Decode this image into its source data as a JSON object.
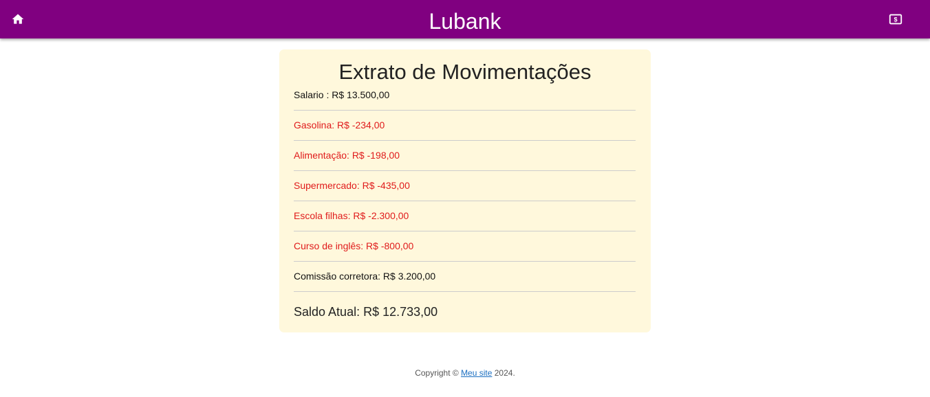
{
  "header": {
    "brand": "Lubank",
    "home_icon": "home-icon",
    "money_icon": "money-icon",
    "background": "#800080"
  },
  "statement": {
    "title": "Extrato de Movimentações",
    "transactions": [
      {
        "text": "Salario : R$ 13.500,00",
        "type": "credit"
      },
      {
        "text": "Gasolina: R$ -234,00",
        "type": "debit"
      },
      {
        "text": "Alimentação: R$ -198,00",
        "type": "debit"
      },
      {
        "text": "Supermercado: R$ -435,00",
        "type": "debit"
      },
      {
        "text": "Escola filhas: R$ -2.300,00",
        "type": "debit"
      },
      {
        "text": "Curso de inglês: R$ -800,00",
        "type": "debit"
      },
      {
        "text": "Comissão corretora: R$ 3.200,00",
        "type": "credit"
      }
    ],
    "balance": "Saldo Atual: R$ 12.733,00",
    "card_color": "#fff8dc",
    "debit_color": "#e01b1b"
  },
  "footer": {
    "prefix": "Copyright © ",
    "link_text": "Meu site",
    "suffix": " 2024."
  }
}
